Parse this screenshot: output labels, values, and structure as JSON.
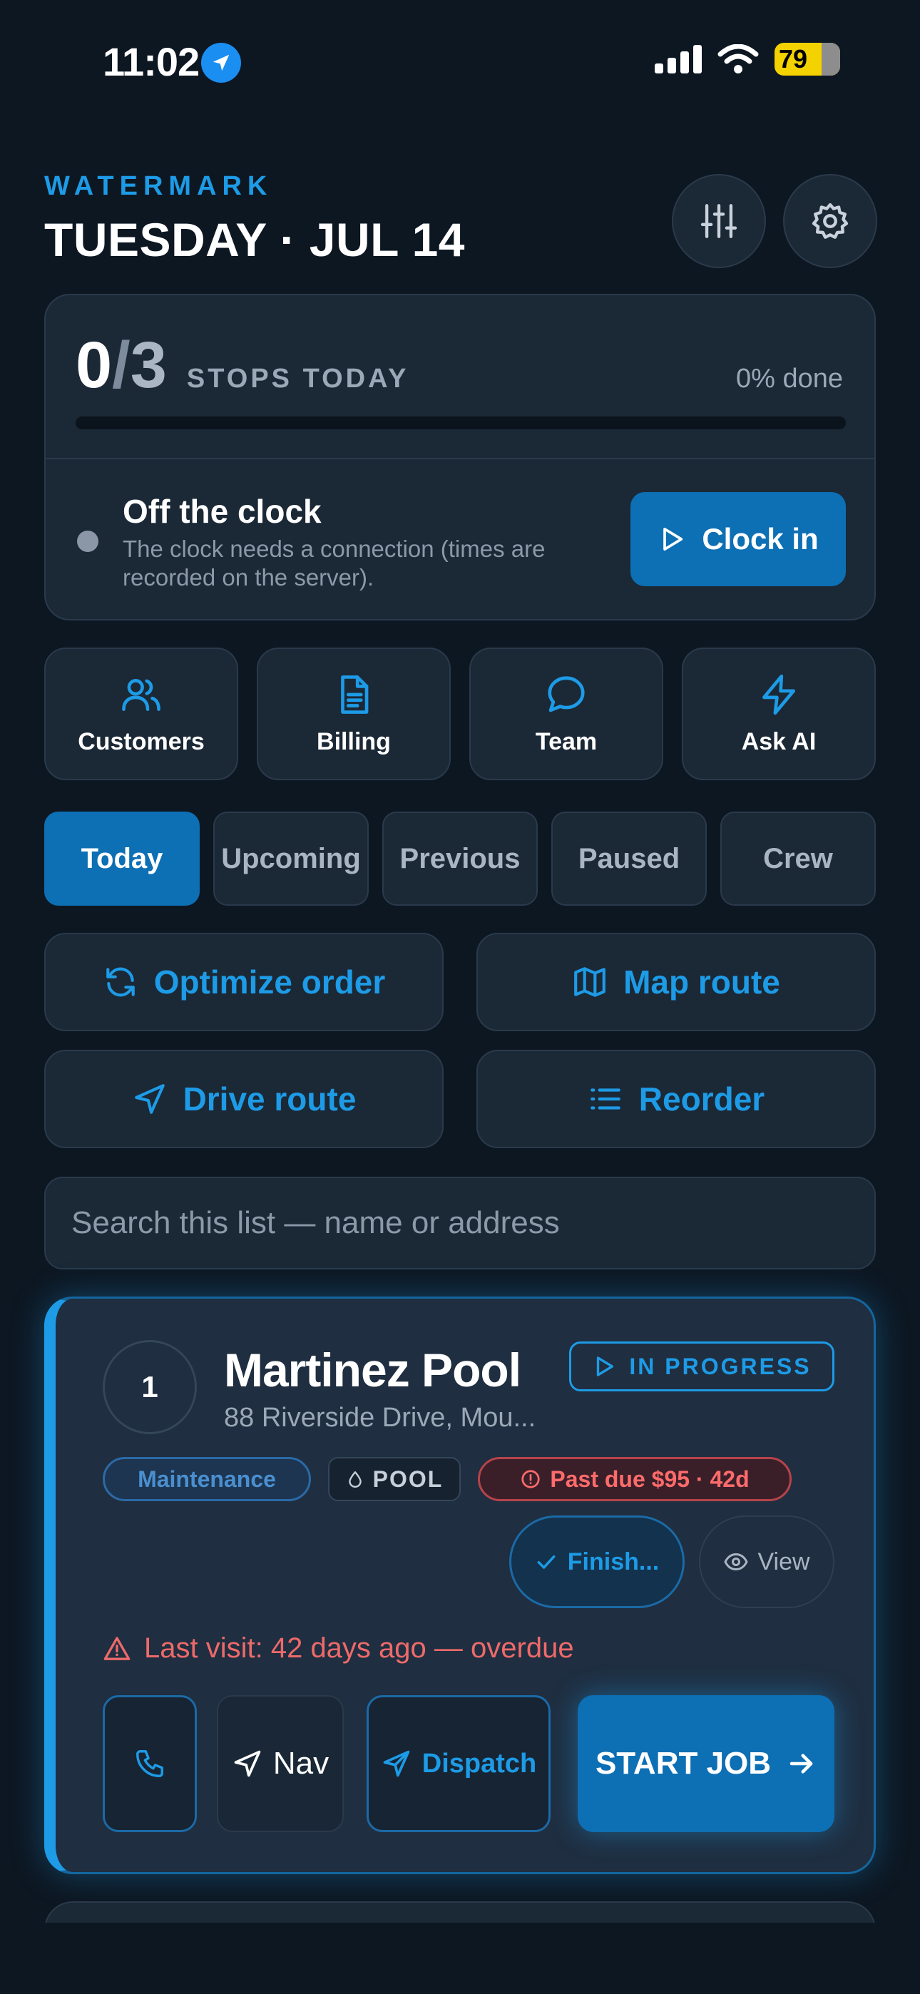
{
  "status_bar": {
    "time": "11:02",
    "battery": "79"
  },
  "header": {
    "brand": "WATERMARK",
    "date": "TUESDAY · JUL 14"
  },
  "stats": {
    "completed": "0",
    "separator": "/",
    "total": "3",
    "label": "STOPS TODAY",
    "percent_text": "0% done",
    "progress_fraction": 0
  },
  "clock": {
    "title": "Off the clock",
    "subtitle": "The clock needs a connection (times are recorded on the server).",
    "button_label": "Clock in"
  },
  "quick_links": [
    {
      "label": "Customers",
      "icon": "users-icon"
    },
    {
      "label": "Billing",
      "icon": "document-icon"
    },
    {
      "label": "Team",
      "icon": "chat-icon"
    },
    {
      "label": "Ask AI",
      "icon": "lightning-icon"
    }
  ],
  "tabs": [
    {
      "label": "Today",
      "active": true
    },
    {
      "label": "Upcoming",
      "active": false
    },
    {
      "label": "Previous",
      "active": false
    },
    {
      "label": "Paused",
      "active": false
    },
    {
      "label": "Crew",
      "active": false
    }
  ],
  "route_actions": {
    "optimize": "Optimize order",
    "map": "Map route",
    "drive": "Drive route",
    "reorder": "Reorder"
  },
  "search": {
    "placeholder": "Search this list — name or address",
    "value": ""
  },
  "job": {
    "number": "1",
    "name": "Martinez Pool",
    "address": "88 Riverside Drive, Mou...",
    "status": "IN PROGRESS",
    "tags": {
      "service": "Maintenance",
      "type": "POOL",
      "past_due": "Past due $95 · 42d"
    },
    "finish_label": "Finish...",
    "view_label": "View",
    "warning": "Last visit: 42 days ago — overdue",
    "nav_label": "Nav",
    "dispatch_label": "Dispatch",
    "start_label": "START JOB"
  },
  "colors": {
    "background": "#0d1722",
    "card": "#1b2836",
    "accent": "#1d9be6",
    "primary_button": "#0d6fb4",
    "danger": "#ee6a6a"
  }
}
